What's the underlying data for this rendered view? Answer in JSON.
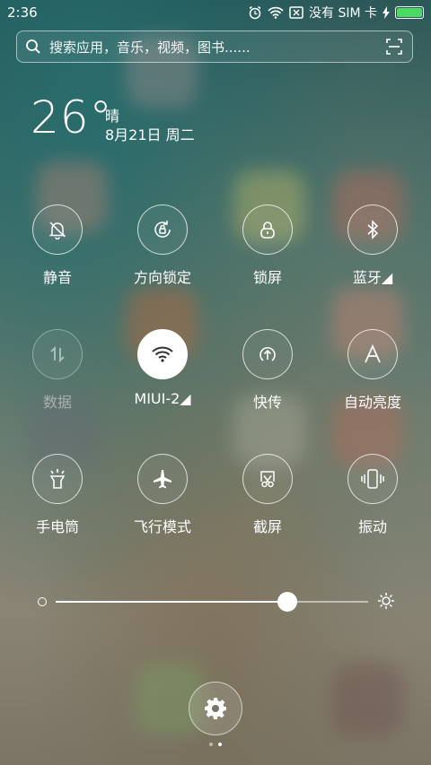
{
  "status_bar": {
    "time": "2:36",
    "sim_text": "没有 SIM 卡",
    "battery_color": "#4cd964"
  },
  "search": {
    "placeholder": "搜索应用，音乐，视频，图书......"
  },
  "weather": {
    "temperature": "26°",
    "condition": "晴",
    "date": "8月21日 周二"
  },
  "toggles": [
    {
      "label": "静音",
      "icon": "bell-off-icon",
      "active": false
    },
    {
      "label": "方向锁定",
      "icon": "rotation-lock-icon",
      "active": false
    },
    {
      "label": "锁屏",
      "icon": "lock-icon",
      "active": false
    },
    {
      "label": "蓝牙◢",
      "icon": "bluetooth-icon",
      "active": false
    },
    {
      "label": "数据",
      "icon": "mobile-data-icon",
      "active": false,
      "disabled": true
    },
    {
      "label": "MIUI-2◢",
      "icon": "wifi-icon",
      "active": true
    },
    {
      "label": "快传",
      "icon": "quick-transfer-icon",
      "active": false
    },
    {
      "label": "自动亮度",
      "icon": "auto-brightness-icon",
      "active": false
    },
    {
      "label": "手电筒",
      "icon": "flashlight-icon",
      "active": false
    },
    {
      "label": "飞行模式",
      "icon": "airplane-icon",
      "active": false
    },
    {
      "label": "截屏",
      "icon": "screenshot-icon",
      "active": false
    },
    {
      "label": "振动",
      "icon": "vibrate-icon",
      "active": false
    }
  ],
  "brightness": {
    "level": 0.74
  },
  "pager": {
    "page": 2,
    "total": 2
  }
}
